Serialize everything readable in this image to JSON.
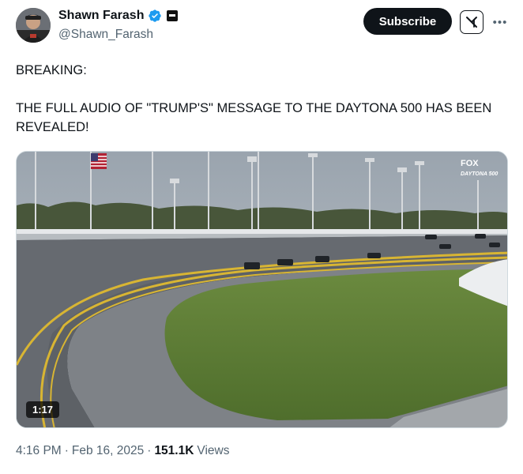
{
  "author": {
    "display_name": "Shawn Farash",
    "handle": "@Shawn_Farash",
    "verified": true
  },
  "actions": {
    "subscribe_label": "Subscribe",
    "grok_icon": "grok-icon",
    "more_icon": "more-icon"
  },
  "tweet": {
    "line1": "BREAKING:",
    "line2": "THE FULL AUDIO OF \"TRUMP'S\" MESSAGE TO THE DAYTONA 500 HAS BEEN REVEALED!"
  },
  "media": {
    "duration": "1:17",
    "broadcast_logo": "FOX",
    "broadcast_sub": "DAYTONA 500"
  },
  "meta": {
    "time": "4:16 PM",
    "sep1": "·",
    "date": "Feb 16, 2025",
    "sep2": "·",
    "views_count": "151.1K",
    "views_label": "Views"
  },
  "colors": {
    "text_primary": "#0f1419",
    "text_secondary": "#536471",
    "verified_blue": "#1d9bf0",
    "button_dark": "#0f1419"
  }
}
